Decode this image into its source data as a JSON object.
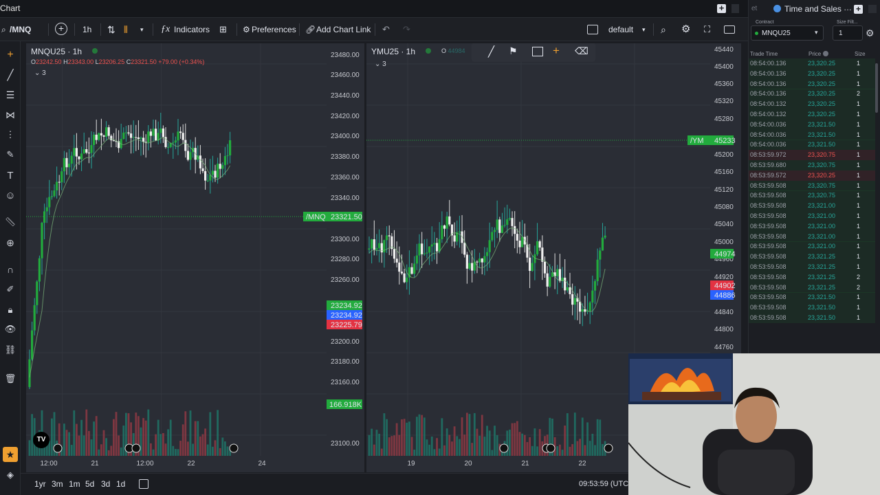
{
  "window": {
    "title": "Chart",
    "tas_tab_title": "Time and Sales",
    "tas_prev_tab": "et"
  },
  "toolbar": {
    "symbol": "/MNQ",
    "interval": "1h",
    "indicators_label": "Indicators",
    "preferences_label": "Preferences",
    "add_chart_link_label": "Add Chart Link",
    "layout_label": "default"
  },
  "left_chart": {
    "title": "MNQU25 · 1h",
    "ohlc_o": "O",
    "ohlc_o_val": "23242.50",
    "ohlc_h": "H",
    "ohlc_h_val": "23343.00",
    "ohlc_l": "L",
    "ohlc_l_val": "23206.25",
    "ohlc_c": "C",
    "ohlc_c_val": "23321.50",
    "ohlc_chg": "+79.00 (+0.34%)",
    "collapse_count": "3",
    "price_ticks": [
      "23480.00",
      "23460.00",
      "23440.00",
      "23420.00",
      "23400.00",
      "23380.00",
      "23360.00",
      "23340.00",
      "23300.00",
      "23280.00",
      "23260.00",
      "23200.00",
      "23180.00",
      "23160.00",
      "23100.00"
    ],
    "last_label": "/MNQ",
    "last_price": "23321.50",
    "tags": [
      "23234.92",
      "23234.92",
      "23225.79"
    ],
    "volume_tag": "166.918K",
    "time_ticks": [
      "12:00",
      "21",
      "12:00",
      "22",
      "24"
    ]
  },
  "right_chart": {
    "title": "YMU25 · 1h",
    "ohlc_o": "O",
    "ohlc_o_val": "44984",
    "collapse_count": "3",
    "price_ticks": [
      "45440",
      "45400",
      "45360",
      "45320",
      "45280",
      "45200",
      "45160",
      "45120",
      "45080",
      "45040",
      "45000",
      "44960",
      "44920",
      "44840",
      "44800",
      "44760"
    ],
    "last_label": "/YM",
    "last_price": "45233",
    "tags": [
      "44974",
      "44902",
      "44886"
    ],
    "time_ticks": [
      "19",
      "20",
      "21",
      "22"
    ]
  },
  "bottom": {
    "ranges": [
      "1yr",
      "3m",
      "1m",
      "5d",
      "3d",
      "1d"
    ],
    "clock": "09:53:59 (UTC"
  },
  "tas": {
    "contract_label": "Contract",
    "contract_value": "MNQU25",
    "size_filter_label": "Size Filt...",
    "size_filter_value": "1",
    "col_time": "Trade Time",
    "col_price": "Price",
    "col_size": "Size",
    "rows": [
      {
        "time": "08:54:00.136",
        "price": "23,320.25",
        "size": "1",
        "color": "green"
      },
      {
        "time": "08:54:00.136",
        "price": "23,320.25",
        "size": "1",
        "color": "green"
      },
      {
        "time": "08:54:00.136",
        "price": "23,320.25",
        "size": "1",
        "color": "green"
      },
      {
        "time": "08:54:00.136",
        "price": "23,320.25",
        "size": "2",
        "color": "green"
      },
      {
        "time": "08:54:00.132",
        "price": "23,320.25",
        "size": "1",
        "color": "green"
      },
      {
        "time": "08:54:00.132",
        "price": "23,320.25",
        "size": "1",
        "color": "green"
      },
      {
        "time": "08:54:00.036",
        "price": "23,321.50",
        "size": "1",
        "color": "green"
      },
      {
        "time": "08:54:00.036",
        "price": "23,321.50",
        "size": "1",
        "color": "green"
      },
      {
        "time": "08:54:00.036",
        "price": "23,321.50",
        "size": "1",
        "color": "green"
      },
      {
        "time": "08:53:59.972",
        "price": "23,320.75",
        "size": "1",
        "color": "red"
      },
      {
        "time": "08:53:59.680",
        "price": "23,320.75",
        "size": "1",
        "color": "green"
      },
      {
        "time": "08:53:59.572",
        "price": "23,320.25",
        "size": "1",
        "color": "red"
      },
      {
        "time": "08:53:59.508",
        "price": "23,320.75",
        "size": "1",
        "color": "green"
      },
      {
        "time": "08:53:59.508",
        "price": "23,320.75",
        "size": "1",
        "color": "green"
      },
      {
        "time": "08:53:59.508",
        "price": "23,321.00",
        "size": "1",
        "color": "green"
      },
      {
        "time": "08:53:59.508",
        "price": "23,321.00",
        "size": "1",
        "color": "green"
      },
      {
        "time": "08:53:59.508",
        "price": "23,321.00",
        "size": "1",
        "color": "green"
      },
      {
        "time": "08:53:59.508",
        "price": "23,321.00",
        "size": "1",
        "color": "green"
      },
      {
        "time": "08:53:59.508",
        "price": "23,321.00",
        "size": "1",
        "color": "green"
      },
      {
        "time": "08:53:59.508",
        "price": "23,321.25",
        "size": "1",
        "color": "green"
      },
      {
        "time": "08:53:59.508",
        "price": "23,321.25",
        "size": "1",
        "color": "green"
      },
      {
        "time": "08:53:59.508",
        "price": "23,321.25",
        "size": "2",
        "color": "green"
      },
      {
        "time": "08:53:59.508",
        "price": "23,321.25",
        "size": "2",
        "color": "green"
      },
      {
        "time": "08:53:59.508",
        "price": "23,321.50",
        "size": "1",
        "color": "green"
      },
      {
        "time": "08:53:59.508",
        "price": "23,321.50",
        "size": "1",
        "color": "green"
      },
      {
        "time": "08:53:59.508",
        "price": "23,321.50",
        "size": "1",
        "color": "green"
      }
    ]
  },
  "colors": {
    "up": "#26a69a",
    "down": "#ef5350",
    "green_tag": "#22ab3d",
    "red_tag": "#e33242",
    "blue_tag": "#2962ff",
    "panel": "#2a2d35"
  }
}
